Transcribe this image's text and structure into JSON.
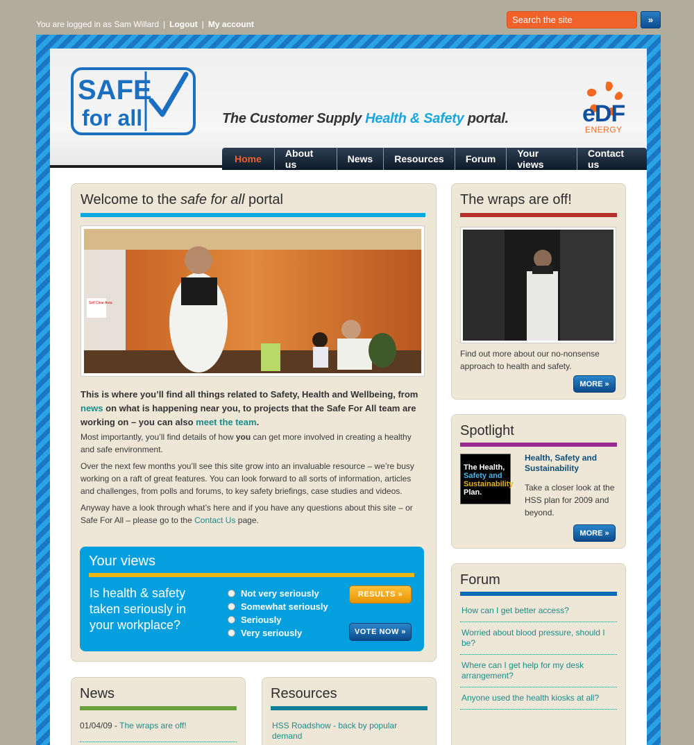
{
  "topbar": {
    "login_prefix": "You are logged in as Sam Willard",
    "logout": "Logout",
    "my_account": "My account",
    "search_placeholder": "Search the site",
    "search_go": "»"
  },
  "header": {
    "logo_line1": "SAFE",
    "logo_line2": "for all",
    "tagline_pre": "The Customer Supply ",
    "tagline_hl": "Health & Safety",
    "tagline_post": " portal.",
    "brand": "eDF",
    "brand_sub": "ENERGY"
  },
  "nav": [
    "Home",
    "About us",
    "News",
    "Resources",
    "Forum",
    "Your views",
    "Contact us"
  ],
  "welcome": {
    "title_pre": "Welcome to the ",
    "title_em": "safe for all",
    "title_post": " portal",
    "sign_text": "Self Clear Area",
    "intro_1": "This is where you’ll find all things related to Safety, Health and Wellbeing, from ",
    "intro_link1": "news",
    "intro_2": " on what is happening near you, to projects that the Safe For All team are working on – you can also ",
    "intro_link2": "meet the team",
    "intro_3": ".",
    "p1_pre": "Most importantly, you’ll find details of how ",
    "p1_bold": "you",
    "p1_post": " can get more involved in creating a healthy and safe environment.",
    "p2": "Over the next few months you’ll see this site grow into an invaluable resource – we’re busy working on a raft of great features. You can look forward to all sorts of information, articles and challenges, from polls and forums, to key safety briefings, case studies and videos.",
    "p3_pre": "Anyway have a look through what’s here and if you have any questions about this site – or Safe For All – please go to the ",
    "p3_link": "Contact Us",
    "p3_post": " page."
  },
  "views": {
    "title": "Your views",
    "question": "Is health & safety taken seriously in your workplace?",
    "options": [
      "Not very seriously",
      "Somewhat seriously",
      "Seriously",
      "Very seriously"
    ],
    "results": "RESULTS",
    "vote": "VOTE NOW"
  },
  "wraps": {
    "title": "The wraps are off!",
    "text": "Find out more about our no-nonsense approach to health and safety.",
    "more": "MORE"
  },
  "spotlight": {
    "title": "Spotlight",
    "img_line1": "The Health,",
    "img_line2": "Safety and",
    "img_line3": "Sustainability",
    "img_line4": "Plan.",
    "item_title": "Health, Safety and Sustainability",
    "item_text": "Take a closer look at the HSS plan for 2009 and beyond.",
    "more": "MORE"
  },
  "forum": {
    "title": "Forum",
    "items": [
      "How can I get better access?",
      "Worried about blood pressure, should I be?",
      "Where can I get help for my desk arrangement?",
      "Anyone used the health kiosks at all?"
    ]
  },
  "news": {
    "title": "News",
    "date": "01/04/09",
    "dash": " - ",
    "link": "The wraps are off!"
  },
  "resources": {
    "title": "Resources",
    "item": "HSS Roadshow - back by popular demand"
  },
  "icons": {
    "arrow": "double-chevron-right-icon"
  },
  "colors": {
    "accent_blue": "#049fdf",
    "brand_orange": "#f15f2e",
    "link_teal": "#1a8c8c"
  }
}
